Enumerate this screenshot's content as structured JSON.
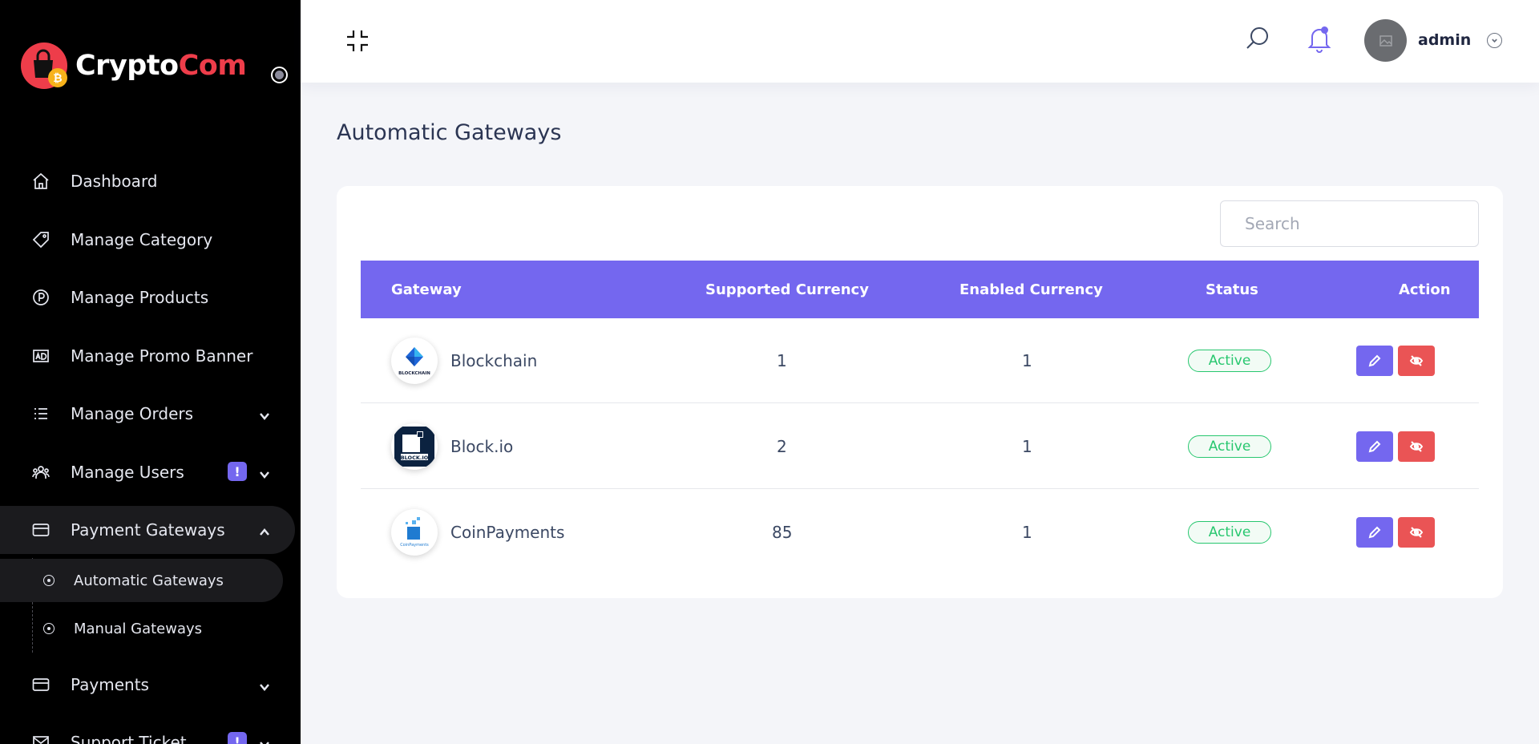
{
  "brand": {
    "name_main": "Crypto",
    "name_accent": "Com"
  },
  "sidebar": {
    "items": [
      {
        "label": "Dashboard"
      },
      {
        "label": "Manage Category"
      },
      {
        "label": "Manage Products"
      },
      {
        "label": "Manage Promo Banner"
      },
      {
        "label": "Manage Orders"
      },
      {
        "label": "Manage Users",
        "badge": "!"
      },
      {
        "label": "Payment Gateways"
      },
      {
        "label": "Payments"
      },
      {
        "label": "Support Ticket",
        "badge": "!"
      }
    ],
    "sub_items": [
      {
        "label": "Automatic Gateways"
      },
      {
        "label": "Manual Gateways"
      }
    ]
  },
  "header": {
    "user_name": "admin"
  },
  "page": {
    "title": "Automatic Gateways"
  },
  "search": {
    "placeholder": "Search"
  },
  "table": {
    "headers": [
      "Gateway",
      "Supported Currency",
      "Enabled Currency",
      "Status",
      "Action"
    ],
    "rows": [
      {
        "gateway": "Blockchain",
        "logo_text": "BLOCKCHAIN",
        "supported": "1",
        "enabled": "1",
        "status": "Active"
      },
      {
        "gateway": "Block.io",
        "logo_text": "BLOCK.IO",
        "supported": "2",
        "enabled": "1",
        "status": "Active"
      },
      {
        "gateway": "CoinPayments",
        "logo_text": "CoinPayments",
        "supported": "85",
        "enabled": "1",
        "status": "Active"
      }
    ]
  },
  "colors": {
    "accent": "#7467ef",
    "danger": "#ea5455",
    "success": "#28c76f",
    "brand_red": "#ee3d4a",
    "sidebar_bg": "#000000"
  },
  "icons": {
    "nav": [
      "home-icon",
      "tag-icon",
      "p-circle-icon",
      "ad-icon",
      "list-icon",
      "users-icon",
      "card-icon",
      "card-icon",
      "ticket-icon"
    ]
  }
}
